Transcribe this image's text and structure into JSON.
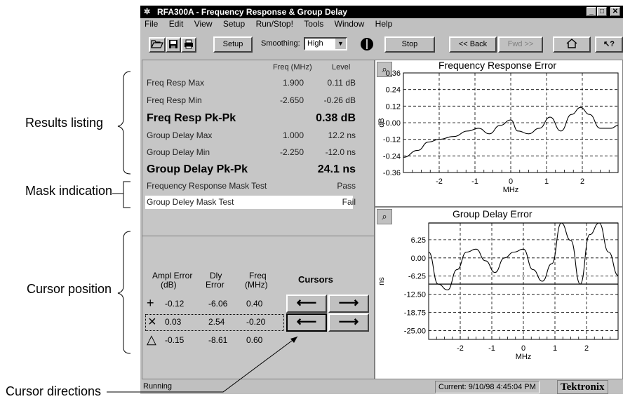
{
  "window": {
    "title": "RFA300A - Frequency Response & Group Delay",
    "minimize": "_",
    "maximize": "□",
    "close": "✕"
  },
  "menu": [
    "File",
    "Edit",
    "View",
    "Setup",
    "Run/Stop!",
    "Tools",
    "Window",
    "Help"
  ],
  "toolbar": {
    "setup_label": "Setup",
    "smoothing_label": "Smoothing:",
    "smoothing_value": "High",
    "stop_label": "Stop",
    "back_label": "<< Back",
    "fwd_label": "Fwd >>"
  },
  "results": {
    "col_freq": "Freq (MHz)",
    "col_level": "Level",
    "rows": [
      {
        "label": "Freq Resp Max",
        "freq": "1.900",
        "level": "0.11 dB"
      },
      {
        "label": "Freq Resp Min",
        "freq": "-2.650",
        "level": "-0.26 dB"
      },
      {
        "label": "Freq Resp Pk-Pk",
        "freq": "",
        "level": "0.38 dB"
      },
      {
        "label": "Group Delay Max",
        "freq": "1.000",
        "level": "12.2 ns"
      },
      {
        "label": "Group Delay Min",
        "freq": "-2.250",
        "level": "-12.0 ns"
      },
      {
        "label": "Group Delay Pk-Pk",
        "freq": "",
        "level": "24.1 ns"
      }
    ],
    "mask": [
      {
        "label": "Frequency Response Mask Test",
        "result": "Pass"
      },
      {
        "label": "Group Deley Mask Test",
        "result": "Fail"
      }
    ]
  },
  "cursor_table": {
    "h_ampl": "Ampl Error",
    "h_ampl_unit": "(dB)",
    "h_dly": "Dly",
    "h_dly_unit": "Error",
    "h_freq": "Freq",
    "h_freq_unit": "(MHz)",
    "cursors_label": "Cursors",
    "rows": [
      {
        "symbol": "+",
        "ampl": "-0.12",
        "dly": "-6.06",
        "freq": "0.40"
      },
      {
        "symbol": "×",
        "ampl": "0.03",
        "dly": "2.54",
        "freq": "-0.20"
      },
      {
        "symbol": "△",
        "ampl": "-0.15",
        "dly": "-8.61",
        "freq": "0.60"
      }
    ]
  },
  "status": {
    "left": "Running",
    "current": "Current: 9/10/98 4:45:04 PM",
    "brand": "Tektronix"
  },
  "annotations": {
    "results": "Results listing",
    "mask": "Mask indication",
    "cursor": "Cursor position",
    "directions": "Cursor directions"
  },
  "chart_data": [
    {
      "type": "line",
      "title": "Frequency Response Error",
      "xlabel": "MHz",
      "ylabel": "dB",
      "x_ticks": [
        "-2",
        "-1",
        "0",
        "1",
        "2"
      ],
      "y_ticks": [
        "0.36",
        "0.24",
        "0.12",
        "-0.00",
        "-0.12",
        "-0.24",
        "-0.36"
      ],
      "xlim": [
        -3.0,
        3.0
      ],
      "ylim": [
        -0.36,
        0.36
      ],
      "grid": true,
      "x": [
        -3.0,
        -2.6,
        -2.3,
        -2.0,
        -1.6,
        -1.2,
        -0.9,
        -0.6,
        -0.3,
        0.0,
        0.2,
        0.5,
        0.8,
        1.1,
        1.4,
        1.7,
        1.95,
        2.2,
        2.5,
        2.8,
        3.0
      ],
      "y": [
        -0.25,
        -0.2,
        -0.14,
        -0.12,
        -0.1,
        -0.06,
        -0.04,
        -0.08,
        -0.02,
        0.02,
        -0.06,
        -0.08,
        -0.04,
        0.04,
        -0.06,
        0.06,
        0.11,
        0.06,
        -0.04,
        -0.04,
        -0.02
      ]
    },
    {
      "type": "line",
      "title": "Group Delay Error",
      "xlabel": "MHz",
      "ylabel": "ns",
      "x_ticks": [
        "-2",
        "-1",
        "0",
        "1",
        "2"
      ],
      "y_ticks": [
        "6.25",
        "0.00",
        "-6.25",
        "-12.50",
        "-18.75",
        "-25.00"
      ],
      "xlim": [
        -3.0,
        3.0
      ],
      "ylim": [
        -28.0,
        12.0
      ],
      "grid": true,
      "mask_upper": 12.0,
      "mask_lower": -9.0,
      "x": [
        -3.0,
        -2.7,
        -2.4,
        -2.1,
        -1.8,
        -1.5,
        -1.2,
        -0.9,
        -0.6,
        -0.3,
        0.0,
        0.3,
        0.6,
        0.9,
        1.2,
        1.5,
        1.8,
        2.1,
        2.4,
        2.7,
        3.0
      ],
      "y": [
        2.0,
        -9.0,
        -11.0,
        -4.0,
        2.0,
        3.0,
        -1.0,
        -5.0,
        0.0,
        2.0,
        3.0,
        -4.0,
        -8.0,
        -2.0,
        12.0,
        6.0,
        -9.0,
        8.0,
        12.0,
        2.0,
        -6.0
      ]
    }
  ]
}
